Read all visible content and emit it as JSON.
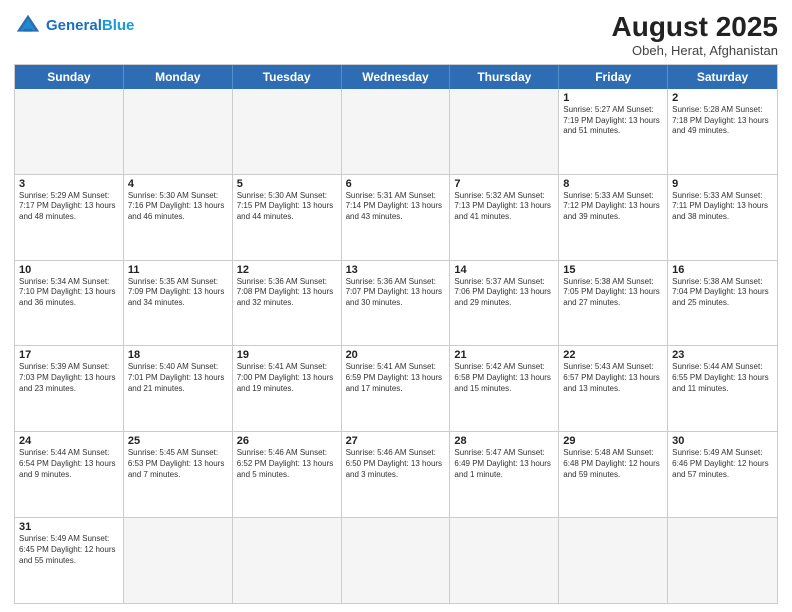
{
  "header": {
    "logo_general": "General",
    "logo_blue": "Blue",
    "month_year": "August 2025",
    "location": "Obeh, Herat, Afghanistan"
  },
  "days_of_week": [
    "Sunday",
    "Monday",
    "Tuesday",
    "Wednesday",
    "Thursday",
    "Friday",
    "Saturday"
  ],
  "weeks": [
    [
      {
        "day": "",
        "info": "",
        "empty": true
      },
      {
        "day": "",
        "info": "",
        "empty": true
      },
      {
        "day": "",
        "info": "",
        "empty": true
      },
      {
        "day": "",
        "info": "",
        "empty": true
      },
      {
        "day": "",
        "info": "",
        "empty": true
      },
      {
        "day": "1",
        "info": "Sunrise: 5:27 AM\nSunset: 7:19 PM\nDaylight: 13 hours\nand 51 minutes.",
        "empty": false
      },
      {
        "day": "2",
        "info": "Sunrise: 5:28 AM\nSunset: 7:18 PM\nDaylight: 13 hours\nand 49 minutes.",
        "empty": false
      }
    ],
    [
      {
        "day": "3",
        "info": "Sunrise: 5:29 AM\nSunset: 7:17 PM\nDaylight: 13 hours\nand 48 minutes.",
        "empty": false
      },
      {
        "day": "4",
        "info": "Sunrise: 5:30 AM\nSunset: 7:16 PM\nDaylight: 13 hours\nand 46 minutes.",
        "empty": false
      },
      {
        "day": "5",
        "info": "Sunrise: 5:30 AM\nSunset: 7:15 PM\nDaylight: 13 hours\nand 44 minutes.",
        "empty": false
      },
      {
        "day": "6",
        "info": "Sunrise: 5:31 AM\nSunset: 7:14 PM\nDaylight: 13 hours\nand 43 minutes.",
        "empty": false
      },
      {
        "day": "7",
        "info": "Sunrise: 5:32 AM\nSunset: 7:13 PM\nDaylight: 13 hours\nand 41 minutes.",
        "empty": false
      },
      {
        "day": "8",
        "info": "Sunrise: 5:33 AM\nSunset: 7:12 PM\nDaylight: 13 hours\nand 39 minutes.",
        "empty": false
      },
      {
        "day": "9",
        "info": "Sunrise: 5:33 AM\nSunset: 7:11 PM\nDaylight: 13 hours\nand 38 minutes.",
        "empty": false
      }
    ],
    [
      {
        "day": "10",
        "info": "Sunrise: 5:34 AM\nSunset: 7:10 PM\nDaylight: 13 hours\nand 36 minutes.",
        "empty": false
      },
      {
        "day": "11",
        "info": "Sunrise: 5:35 AM\nSunset: 7:09 PM\nDaylight: 13 hours\nand 34 minutes.",
        "empty": false
      },
      {
        "day": "12",
        "info": "Sunrise: 5:36 AM\nSunset: 7:08 PM\nDaylight: 13 hours\nand 32 minutes.",
        "empty": false
      },
      {
        "day": "13",
        "info": "Sunrise: 5:36 AM\nSunset: 7:07 PM\nDaylight: 13 hours\nand 30 minutes.",
        "empty": false
      },
      {
        "day": "14",
        "info": "Sunrise: 5:37 AM\nSunset: 7:06 PM\nDaylight: 13 hours\nand 29 minutes.",
        "empty": false
      },
      {
        "day": "15",
        "info": "Sunrise: 5:38 AM\nSunset: 7:05 PM\nDaylight: 13 hours\nand 27 minutes.",
        "empty": false
      },
      {
        "day": "16",
        "info": "Sunrise: 5:38 AM\nSunset: 7:04 PM\nDaylight: 13 hours\nand 25 minutes.",
        "empty": false
      }
    ],
    [
      {
        "day": "17",
        "info": "Sunrise: 5:39 AM\nSunset: 7:03 PM\nDaylight: 13 hours\nand 23 minutes.",
        "empty": false
      },
      {
        "day": "18",
        "info": "Sunrise: 5:40 AM\nSunset: 7:01 PM\nDaylight: 13 hours\nand 21 minutes.",
        "empty": false
      },
      {
        "day": "19",
        "info": "Sunrise: 5:41 AM\nSunset: 7:00 PM\nDaylight: 13 hours\nand 19 minutes.",
        "empty": false
      },
      {
        "day": "20",
        "info": "Sunrise: 5:41 AM\nSunset: 6:59 PM\nDaylight: 13 hours\nand 17 minutes.",
        "empty": false
      },
      {
        "day": "21",
        "info": "Sunrise: 5:42 AM\nSunset: 6:58 PM\nDaylight: 13 hours\nand 15 minutes.",
        "empty": false
      },
      {
        "day": "22",
        "info": "Sunrise: 5:43 AM\nSunset: 6:57 PM\nDaylight: 13 hours\nand 13 minutes.",
        "empty": false
      },
      {
        "day": "23",
        "info": "Sunrise: 5:44 AM\nSunset: 6:55 PM\nDaylight: 13 hours\nand 11 minutes.",
        "empty": false
      }
    ],
    [
      {
        "day": "24",
        "info": "Sunrise: 5:44 AM\nSunset: 6:54 PM\nDaylight: 13 hours\nand 9 minutes.",
        "empty": false
      },
      {
        "day": "25",
        "info": "Sunrise: 5:45 AM\nSunset: 6:53 PM\nDaylight: 13 hours\nand 7 minutes.",
        "empty": false
      },
      {
        "day": "26",
        "info": "Sunrise: 5:46 AM\nSunset: 6:52 PM\nDaylight: 13 hours\nand 5 minutes.",
        "empty": false
      },
      {
        "day": "27",
        "info": "Sunrise: 5:46 AM\nSunset: 6:50 PM\nDaylight: 13 hours\nand 3 minutes.",
        "empty": false
      },
      {
        "day": "28",
        "info": "Sunrise: 5:47 AM\nSunset: 6:49 PM\nDaylight: 13 hours\nand 1 minute.",
        "empty": false
      },
      {
        "day": "29",
        "info": "Sunrise: 5:48 AM\nSunset: 6:48 PM\nDaylight: 12 hours\nand 59 minutes.",
        "empty": false
      },
      {
        "day": "30",
        "info": "Sunrise: 5:49 AM\nSunset: 6:46 PM\nDaylight: 12 hours\nand 57 minutes.",
        "empty": false
      }
    ],
    [
      {
        "day": "31",
        "info": "Sunrise: 5:49 AM\nSunset: 6:45 PM\nDaylight: 12 hours\nand 55 minutes.",
        "empty": false
      },
      {
        "day": "",
        "info": "",
        "empty": true
      },
      {
        "day": "",
        "info": "",
        "empty": true
      },
      {
        "day": "",
        "info": "",
        "empty": true
      },
      {
        "day": "",
        "info": "",
        "empty": true
      },
      {
        "day": "",
        "info": "",
        "empty": true
      },
      {
        "day": "",
        "info": "",
        "empty": true
      }
    ]
  ]
}
